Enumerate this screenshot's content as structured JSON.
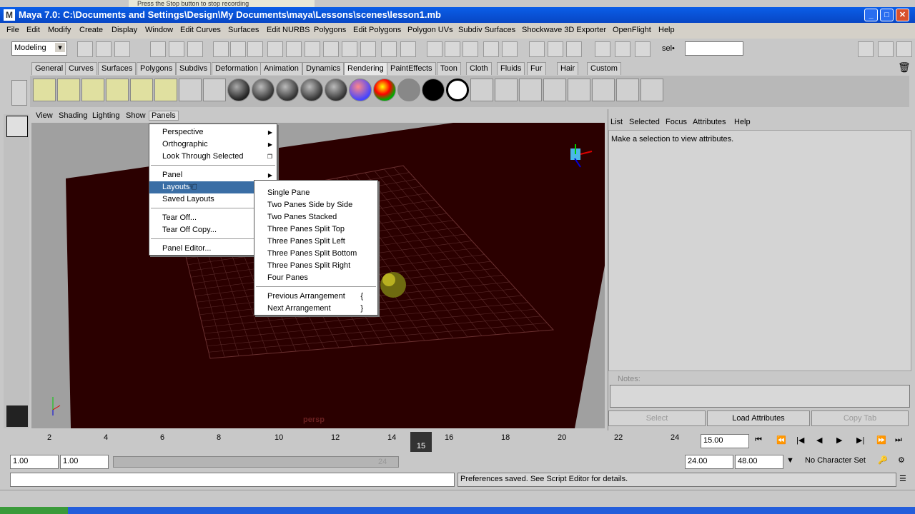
{
  "recording_text": "Press the Stop button to stop recording",
  "window": {
    "title": "Maya 7.0: C:\\Documents and Settings\\Design\\My Documents\\maya\\Lessons\\scenes\\lesson1.mb",
    "logo": "M",
    "min": "_",
    "max": "□",
    "close": "✕"
  },
  "menubar": [
    "File",
    "Edit",
    "Modify",
    "Create",
    "Display",
    "Window",
    "Edit Curves",
    "Surfaces",
    "Edit NURBS",
    "Polygons",
    "Edit Polygons",
    "Polygon UVs",
    "Subdiv Surfaces",
    "Shockwave 3D Exporter",
    "OpenFlight",
    "Help"
  ],
  "status": {
    "mode": "Modeling",
    "sel_label": "sel•"
  },
  "shelf_tabs": [
    "General",
    "Curves",
    "Surfaces",
    "Polygons",
    "Subdivs",
    "Deformation",
    "Animation",
    "Dynamics",
    "Rendering",
    "PaintEffects",
    "Toon",
    "Cloth",
    "Fluids",
    "Fur",
    "Hair",
    "Custom"
  ],
  "active_shelf_tab": "Rendering",
  "viewport_menu": [
    "View",
    "Shading",
    "Lighting",
    "Show",
    "Panels"
  ],
  "viewport_label": "persp",
  "panels_menu": {
    "items": [
      "Perspective",
      "Orthographic",
      "Look Through Selected",
      "Panel",
      "Layouts",
      "Saved Layouts",
      "Tear Off...",
      "Tear Off Copy...",
      "Panel Editor..."
    ]
  },
  "layouts_menu": {
    "items": [
      "Single Pane",
      "Two Panes Side by Side",
      "Two Panes Stacked",
      "Three Panes Split Top",
      "Three Panes Split Left",
      "Three Panes Split Bottom",
      "Three Panes Split Right",
      "Four Panes",
      "Previous Arrangement",
      "Next Arrangement"
    ],
    "shortcuts": {
      "prev": "{",
      "next": "}"
    }
  },
  "attr_panel": {
    "menu": [
      "List",
      "Selected",
      "Focus",
      "Attributes",
      "Help"
    ],
    "message": "Make a selection to view attributes.",
    "notes_label": "Notes:",
    "buttons": [
      "Select",
      "Load Attributes",
      "Copy Tab"
    ]
  },
  "timeline": {
    "ticks": [
      "2",
      "4",
      "6",
      "8",
      "10",
      "12",
      "14",
      "16",
      "18",
      "20",
      "22",
      "24"
    ],
    "current_frame": "15",
    "current_field": "15.00"
  },
  "range": {
    "start": "1.00",
    "start2": "1.00",
    "slider_end": "24",
    "end": "24.00",
    "end2": "48.00",
    "char_set": "No Character Set"
  },
  "help_message": "Preferences saved. See Script Editor for details."
}
